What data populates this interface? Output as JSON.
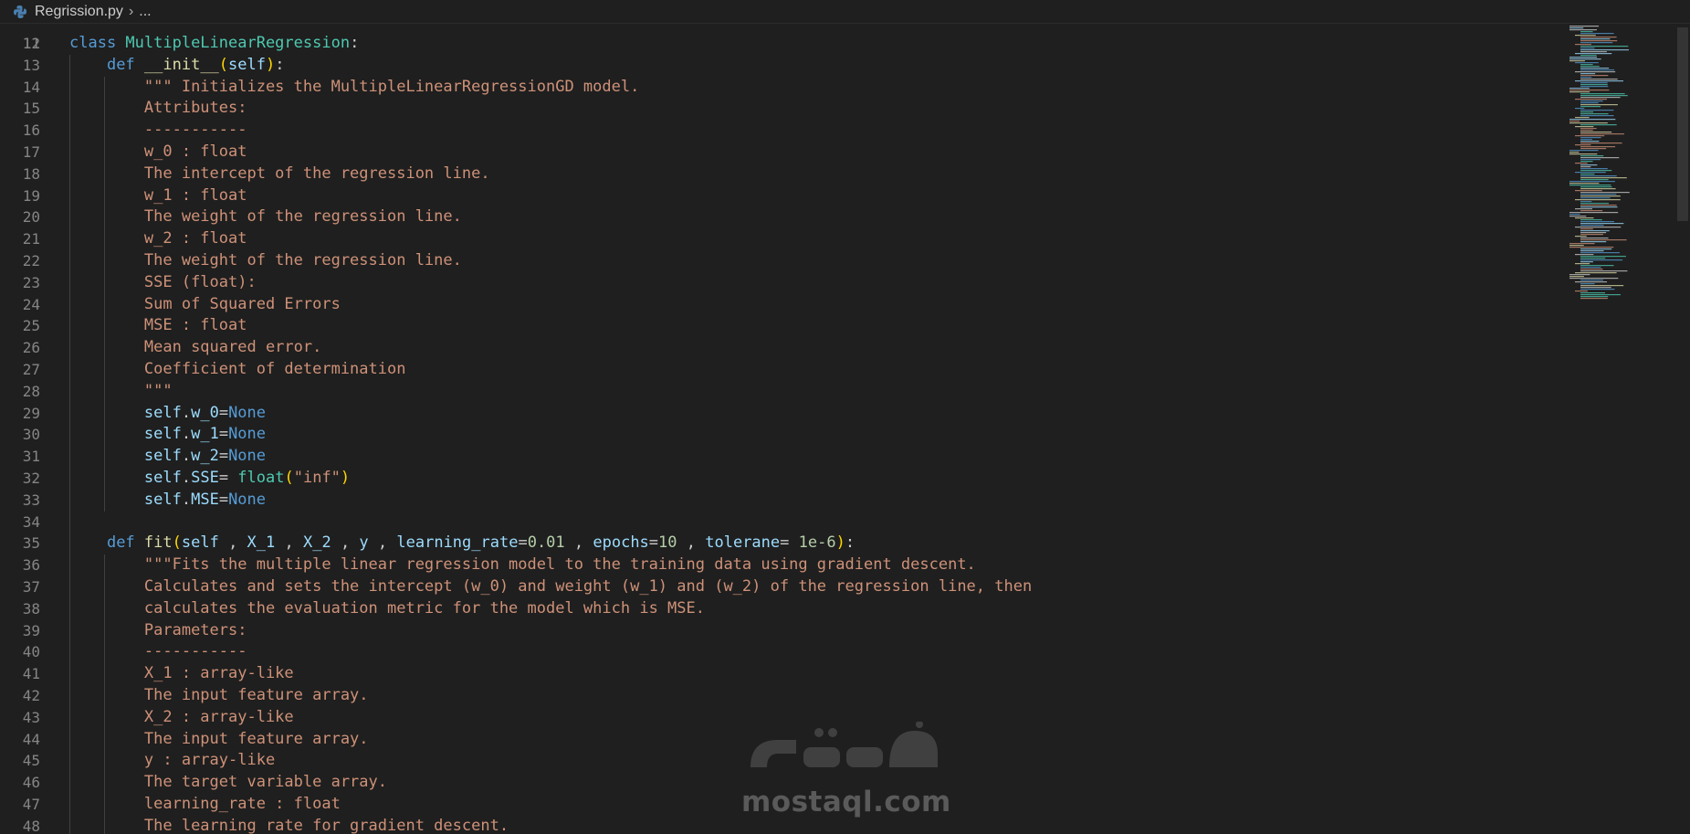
{
  "breadcrumb": {
    "file": "Regrission.py",
    "rest": "..."
  },
  "watermark": "mostaql.com",
  "code_lines": [
    {
      "n": "12",
      "tokens": [
        [
          "kw",
          "class "
        ],
        [
          "cls",
          "MultipleLinearRegression"
        ],
        [
          "plain",
          ":"
        ]
      ]
    },
    {
      "n": "13",
      "tokens": [
        [
          "plain",
          "    "
        ],
        [
          "kw",
          "def "
        ],
        [
          "fn",
          "__init__"
        ],
        [
          "paren",
          "("
        ],
        [
          "self",
          "self"
        ],
        [
          "paren",
          ")"
        ],
        [
          "plain",
          ":"
        ]
      ]
    },
    {
      "n": "14",
      "tokens": [
        [
          "plain",
          "        "
        ],
        [
          "str",
          "\"\"\" Initializes the MultipleLinearRegressionGD model."
        ]
      ]
    },
    {
      "n": "15",
      "tokens": [
        [
          "plain",
          "        "
        ],
        [
          "str",
          "Attributes:"
        ]
      ]
    },
    {
      "n": "16",
      "tokens": [
        [
          "plain",
          "        "
        ],
        [
          "str",
          "-----------"
        ]
      ]
    },
    {
      "n": "17",
      "tokens": [
        [
          "plain",
          "        "
        ],
        [
          "str",
          "w_0 : float"
        ]
      ]
    },
    {
      "n": "18",
      "tokens": [
        [
          "plain",
          "        "
        ],
        [
          "str",
          "The intercept of the regression line."
        ]
      ]
    },
    {
      "n": "19",
      "tokens": [
        [
          "plain",
          "        "
        ],
        [
          "str",
          "w_1 : float"
        ]
      ]
    },
    {
      "n": "20",
      "tokens": [
        [
          "plain",
          "        "
        ],
        [
          "str",
          "The weight of the regression line."
        ]
      ]
    },
    {
      "n": "21",
      "tokens": [
        [
          "plain",
          "        "
        ],
        [
          "str",
          "w_2 : float"
        ]
      ]
    },
    {
      "n": "22",
      "tokens": [
        [
          "plain",
          "        "
        ],
        [
          "str",
          "The weight of the regression line."
        ]
      ]
    },
    {
      "n": "23",
      "tokens": [
        [
          "plain",
          "        "
        ],
        [
          "str",
          "SSE (float):"
        ]
      ]
    },
    {
      "n": "24",
      "tokens": [
        [
          "plain",
          "        "
        ],
        [
          "str",
          "Sum of Squared Errors"
        ]
      ]
    },
    {
      "n": "25",
      "tokens": [
        [
          "plain",
          "        "
        ],
        [
          "str",
          "MSE : float"
        ]
      ]
    },
    {
      "n": "26",
      "tokens": [
        [
          "plain",
          "        "
        ],
        [
          "str",
          "Mean squared error."
        ]
      ]
    },
    {
      "n": "27",
      "tokens": [
        [
          "plain",
          "        "
        ],
        [
          "str",
          "Coefficient of determination"
        ]
      ]
    },
    {
      "n": "28",
      "tokens": [
        [
          "plain",
          "        "
        ],
        [
          "str",
          "\"\"\""
        ]
      ]
    },
    {
      "n": "29",
      "tokens": [
        [
          "plain",
          "        "
        ],
        [
          "self",
          "self"
        ],
        [
          "plain",
          "."
        ],
        [
          "var",
          "w_0"
        ],
        [
          "plain",
          "="
        ],
        [
          "kw",
          "None"
        ]
      ]
    },
    {
      "n": "30",
      "tokens": [
        [
          "plain",
          "        "
        ],
        [
          "self",
          "self"
        ],
        [
          "plain",
          "."
        ],
        [
          "var",
          "w_1"
        ],
        [
          "plain",
          "="
        ],
        [
          "kw",
          "None"
        ]
      ]
    },
    {
      "n": "31",
      "tokens": [
        [
          "plain",
          "        "
        ],
        [
          "self",
          "self"
        ],
        [
          "plain",
          "."
        ],
        [
          "var",
          "w_2"
        ],
        [
          "plain",
          "="
        ],
        [
          "kw",
          "None"
        ]
      ]
    },
    {
      "n": "32",
      "tokens": [
        [
          "plain",
          "        "
        ],
        [
          "self",
          "self"
        ],
        [
          "plain",
          "."
        ],
        [
          "var",
          "SSE"
        ],
        [
          "plain",
          "= "
        ],
        [
          "cls",
          "float"
        ],
        [
          "paren",
          "("
        ],
        [
          "str",
          "\"inf\""
        ],
        [
          "paren",
          ")"
        ]
      ]
    },
    {
      "n": "33",
      "tokens": [
        [
          "plain",
          "        "
        ],
        [
          "self",
          "self"
        ],
        [
          "plain",
          "."
        ],
        [
          "var",
          "MSE"
        ],
        [
          "plain",
          "="
        ],
        [
          "kw",
          "None"
        ]
      ]
    },
    {
      "n": "34",
      "tokens": []
    },
    {
      "n": "35",
      "tokens": [
        [
          "plain",
          "    "
        ],
        [
          "kw",
          "def "
        ],
        [
          "fn",
          "fit"
        ],
        [
          "paren",
          "("
        ],
        [
          "self",
          "self"
        ],
        [
          "plain",
          " , "
        ],
        [
          "var",
          "X_1"
        ],
        [
          "plain",
          " , "
        ],
        [
          "var",
          "X_2"
        ],
        [
          "plain",
          " , "
        ],
        [
          "var",
          "y"
        ],
        [
          "plain",
          " , "
        ],
        [
          "var",
          "learning_rate"
        ],
        [
          "plain",
          "="
        ],
        [
          "num",
          "0.01"
        ],
        [
          "plain",
          " , "
        ],
        [
          "var",
          "epochs"
        ],
        [
          "plain",
          "="
        ],
        [
          "num",
          "10"
        ],
        [
          "plain",
          " , "
        ],
        [
          "var",
          "tolerane"
        ],
        [
          "plain",
          "= "
        ],
        [
          "num",
          "1e-6"
        ],
        [
          "paren",
          ")"
        ],
        [
          "plain",
          ":"
        ]
      ]
    },
    {
      "n": "36",
      "tokens": [
        [
          "plain",
          "        "
        ],
        [
          "str",
          "\"\"\"Fits the multiple linear regression model to the training data using gradient descent."
        ]
      ]
    },
    {
      "n": "37",
      "tokens": [
        [
          "plain",
          "        "
        ],
        [
          "str",
          "Calculates and sets the intercept (w_0) and weight (w_1) and (w_2) of the regression line, then"
        ]
      ]
    },
    {
      "n": "38",
      "tokens": [
        [
          "plain",
          "        "
        ],
        [
          "str",
          "calculates the evaluation metric for the model which is MSE."
        ]
      ]
    },
    {
      "n": "39",
      "tokens": [
        [
          "plain",
          "        "
        ],
        [
          "str",
          "Parameters:"
        ]
      ]
    },
    {
      "n": "40",
      "tokens": [
        [
          "plain",
          "        "
        ],
        [
          "str",
          "-----------"
        ]
      ]
    },
    {
      "n": "41",
      "tokens": [
        [
          "plain",
          "        "
        ],
        [
          "str",
          "X_1 : array-like"
        ]
      ]
    },
    {
      "n": "42",
      "tokens": [
        [
          "plain",
          "        "
        ],
        [
          "str",
          "The input feature array."
        ]
      ]
    },
    {
      "n": "43",
      "tokens": [
        [
          "plain",
          "        "
        ],
        [
          "str",
          "X_2 : array-like"
        ]
      ]
    },
    {
      "n": "44",
      "tokens": [
        [
          "plain",
          "        "
        ],
        [
          "str",
          "The input feature array."
        ]
      ]
    },
    {
      "n": "45",
      "tokens": [
        [
          "plain",
          "        "
        ],
        [
          "str",
          "y : array-like"
        ]
      ]
    },
    {
      "n": "46",
      "tokens": [
        [
          "plain",
          "        "
        ],
        [
          "str",
          "The target variable array."
        ]
      ]
    },
    {
      "n": "47",
      "tokens": [
        [
          "plain",
          "        "
        ],
        [
          "str",
          "learning_rate : float"
        ]
      ]
    },
    {
      "n": "48",
      "tokens": [
        [
          "plain",
          "        "
        ],
        [
          "str",
          "The learning rate for gradient descent."
        ]
      ]
    }
  ],
  "colors": {
    "background": "#1f1f1f",
    "keyword": "#569cd6",
    "class": "#4ec9b0",
    "function": "#dcdcaa",
    "string": "#ce9178",
    "variable": "#9cdcfe",
    "number": "#b5cea8"
  }
}
